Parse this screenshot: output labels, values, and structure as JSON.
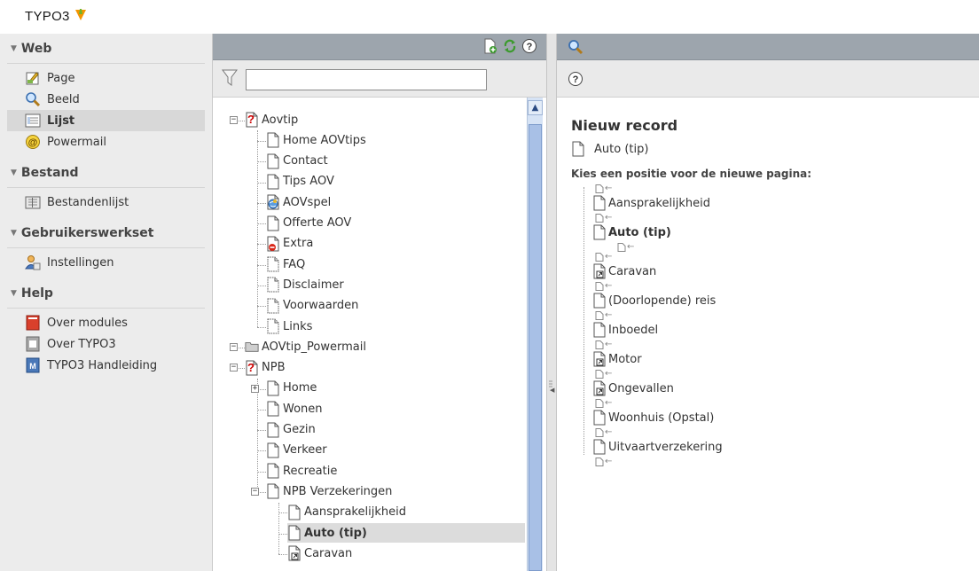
{
  "app": {
    "logo_text": "TYPO3"
  },
  "modules": [
    {
      "header": "Web",
      "items": [
        {
          "label": "Page",
          "icon": "page-module-icon",
          "active": false
        },
        {
          "label": "Beeld",
          "icon": "magnifier-icon",
          "active": false
        },
        {
          "label": "Lijst",
          "icon": "list-icon",
          "active": true
        },
        {
          "label": "Powermail",
          "icon": "powermail-icon",
          "active": false
        }
      ]
    },
    {
      "header": "Bestand",
      "items": [
        {
          "label": "Bestandenlijst",
          "icon": "filelist-icon",
          "active": false
        }
      ]
    },
    {
      "header": "Gebruikerswerkset",
      "items": [
        {
          "label": "Instellingen",
          "icon": "user-settings-icon",
          "active": false
        }
      ]
    },
    {
      "header": "Help",
      "items": [
        {
          "label": "Over modules",
          "icon": "about-modules-icon",
          "active": false
        },
        {
          "label": "Over TYPO3",
          "icon": "about-typo3-icon",
          "active": false
        },
        {
          "label": "TYPO3 Handleiding",
          "icon": "manual-icon",
          "active": false
        }
      ]
    }
  ],
  "tree": {
    "filter": {
      "value": "",
      "placeholder": ""
    },
    "nodes": [
      {
        "label": "Aovtip",
        "level": 0,
        "icon": "root-warning-page-icon",
        "toggler": "-",
        "selected": false
      },
      {
        "label": "Home AOVtips",
        "level": 1,
        "icon": "page-icon",
        "selected": false
      },
      {
        "label": "Contact",
        "level": 1,
        "icon": "page-icon",
        "selected": false
      },
      {
        "label": "Tips AOV",
        "level": 1,
        "icon": "page-icon",
        "selected": false
      },
      {
        "label": "AOVspel",
        "level": 1,
        "icon": "globe-page-icon",
        "selected": false
      },
      {
        "label": "Offerte AOV",
        "level": 1,
        "icon": "page-icon",
        "selected": false
      },
      {
        "label": "Extra",
        "level": 1,
        "icon": "restricted-page-icon",
        "selected": false
      },
      {
        "label": "FAQ",
        "level": 1,
        "icon": "hidden-page-icon",
        "selected": false
      },
      {
        "label": "Disclaimer",
        "level": 1,
        "icon": "hidden-page-icon",
        "selected": false
      },
      {
        "label": "Voorwaarden",
        "level": 1,
        "icon": "hidden-page-icon",
        "selected": false
      },
      {
        "label": "Links",
        "level": 1,
        "icon": "hidden-page-icon",
        "selected": false
      },
      {
        "label": "AOVtip_Powermail",
        "level": 0,
        "icon": "folder-icon",
        "toggler": "-",
        "selected": false
      },
      {
        "label": "NPB",
        "level": 0,
        "icon": "root-warning-page-icon",
        "toggler": "-",
        "selected": false
      },
      {
        "label": "Home",
        "level": 1,
        "icon": "page-icon",
        "toggler": "+",
        "selected": false
      },
      {
        "label": "Wonen",
        "level": 1,
        "icon": "page-icon",
        "selected": false
      },
      {
        "label": "Gezin",
        "level": 1,
        "icon": "page-icon",
        "selected": false
      },
      {
        "label": "Verkeer",
        "level": 1,
        "icon": "page-icon",
        "selected": false
      },
      {
        "label": "Recreatie",
        "level": 1,
        "icon": "page-icon",
        "selected": false
      },
      {
        "label": "NPB Verzekeringen",
        "level": 1,
        "icon": "page-icon",
        "toggler": "-",
        "selected": false
      },
      {
        "label": "Aansprakelijkheid",
        "level": 2,
        "icon": "page-icon",
        "selected": false
      },
      {
        "label": "Auto (tip)",
        "level": 2,
        "icon": "page-icon",
        "selected": true
      },
      {
        "label": "Caravan",
        "level": 2,
        "icon": "shortcut-page-icon",
        "selected": false
      }
    ]
  },
  "content": {
    "title": "Nieuw record",
    "record_label": "Auto (tip)",
    "instruction": "Kies een positie voor de nieuwe pagina:",
    "pages": [
      {
        "label": "Aansprakelijkheid",
        "icon": "page-icon",
        "current": false
      },
      {
        "label": "Auto (tip)",
        "icon": "page-icon",
        "current": true
      },
      {
        "label": "Caravan",
        "icon": "shortcut-page-icon",
        "current": false
      },
      {
        "label": "(Doorlopende) reis",
        "icon": "page-icon",
        "current": false
      },
      {
        "label": "Inboedel",
        "icon": "page-icon",
        "current": false
      },
      {
        "label": "Motor",
        "icon": "shortcut-page-icon",
        "current": false
      },
      {
        "label": "Ongevallen",
        "icon": "shortcut-page-icon",
        "current": false
      },
      {
        "label": "Woonhuis (Opstal)",
        "icon": "page-icon",
        "current": false
      },
      {
        "label": "Uitvaartverzekering",
        "icon": "page-icon",
        "current": false
      }
    ]
  },
  "colors": {
    "toolbar": "#9da5ad",
    "menu_bg": "#ececec",
    "scroll_thumb": "#a8c0e6"
  }
}
